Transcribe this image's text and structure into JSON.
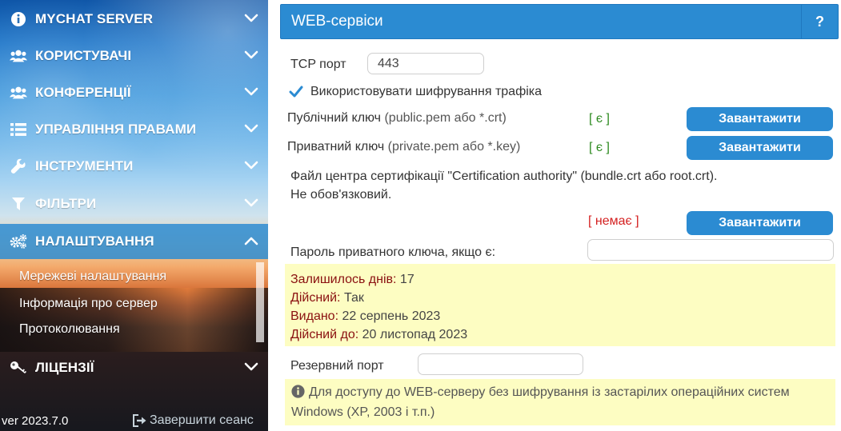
{
  "sidebar": {
    "items": [
      {
        "label": "MYCHAT SERVER",
        "icon": "info-icon"
      },
      {
        "label": "КОРИСТУВАЧІ",
        "icon": "users-icon"
      },
      {
        "label": "КОНФЕРЕНЦІЇ",
        "icon": "users-icon"
      },
      {
        "label": "УПРАВЛІННЯ ПРАВАМИ",
        "icon": "list-icon"
      },
      {
        "label": "ІНСТРУМЕНТИ",
        "icon": "wrench-icon"
      },
      {
        "label": "ФІЛЬТРИ",
        "icon": "filter-icon"
      },
      {
        "label": "НАЛАШТУВАННЯ",
        "icon": "gears-icon"
      },
      {
        "label": "ЛІЦЕНЗІЇ",
        "icon": "key-icon"
      }
    ],
    "subitems": [
      {
        "label": "Мережеві налаштування"
      },
      {
        "label": "Інформація про сервер"
      },
      {
        "label": "Протоколювання"
      }
    ],
    "version": "ver 2023.7.0",
    "logout_label": "Завершити сеанс"
  },
  "header": {
    "title": "WEB-сервіси",
    "help_label": "?"
  },
  "form": {
    "tcp_port_label": "TCP порт",
    "tcp_port_value": "443",
    "encryption_label": "Використовувати шифрування трафіка",
    "public_key_label": "Публічний ключ",
    "public_key_hint": "(public.pem або *.crt)",
    "public_key_status": "[ є ]",
    "private_key_label": "Приватний ключ",
    "private_key_hint": "(private.pem або *.key)",
    "private_key_status": "[ є ]",
    "upload_label": "Завантажити",
    "cert_note_line1": "Файл центра сертифікації \"Certification authority\" (bundle.crt або root.crt).",
    "cert_note_line2": "Не обов'язковий.",
    "cert_status": "[ немає ]",
    "password_label": "Пароль приватного ключа, якщо є:",
    "password_value": "",
    "reserve_port_label": "Резервний порт",
    "reserve_port_value": ""
  },
  "cert_info": {
    "days_left_label": "Залишилось днів",
    "days_left_value": "17",
    "valid_label": "Дійсний",
    "valid_value": "Так",
    "issued_label": "Видано",
    "issued_value": "22 серпень 2023",
    "valid_until_label": "Дійсний до",
    "valid_until_value": "20 листопад 2023"
  },
  "note": {
    "text": "Для доступу до WEB-серверу без шифрування із застарілих операційних систем Windows (XP, 2003 і т.п.)"
  },
  "colors": {
    "accent": "#2b8bd2",
    "status_ok": "#2d8a1f",
    "status_bad": "#d42020",
    "info_bg": "#fdfdc2",
    "info_key": "#8a1010"
  }
}
